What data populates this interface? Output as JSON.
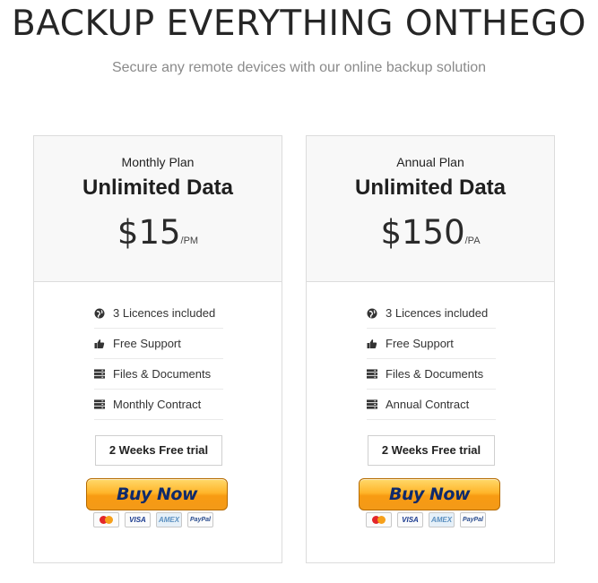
{
  "header": {
    "title": "BACKUP EVERYTHING ONTHEGO",
    "subtitle": "Secure any remote devices with our online backup solution"
  },
  "plans": [
    {
      "name": "Monthly Plan",
      "data": "Unlimited Data",
      "price": "$15",
      "period": "/PM",
      "features": [
        {
          "icon": "globe-icon",
          "label": "3 Licences included"
        },
        {
          "icon": "thumbs-up-icon",
          "label": "Free Support"
        },
        {
          "icon": "server-icon",
          "label": "Files & Documents"
        },
        {
          "icon": "server-icon",
          "label": "Monthly Contract"
        }
      ],
      "trial_label": "2 Weeks Free trial",
      "buy_label": "Buy Now"
    },
    {
      "name": "Annual Plan",
      "data": "Unlimited Data",
      "price": "$150",
      "period": "/PA",
      "features": [
        {
          "icon": "globe-icon",
          "label": "3 Licences included"
        },
        {
          "icon": "thumbs-up-icon",
          "label": "Free Support"
        },
        {
          "icon": "server-icon",
          "label": "Files & Documents"
        },
        {
          "icon": "server-icon",
          "label": "Annual Contract"
        }
      ],
      "trial_label": "2 Weeks Free trial",
      "buy_label": "Buy Now"
    }
  ],
  "payment_cards": [
    "MasterCard",
    "VISA",
    "AMEX",
    "PayPal"
  ],
  "colors": {
    "buy_button": "#ffb52a",
    "buy_text": "#0f2a6b",
    "card_header_bg": "#f8f8f8"
  }
}
